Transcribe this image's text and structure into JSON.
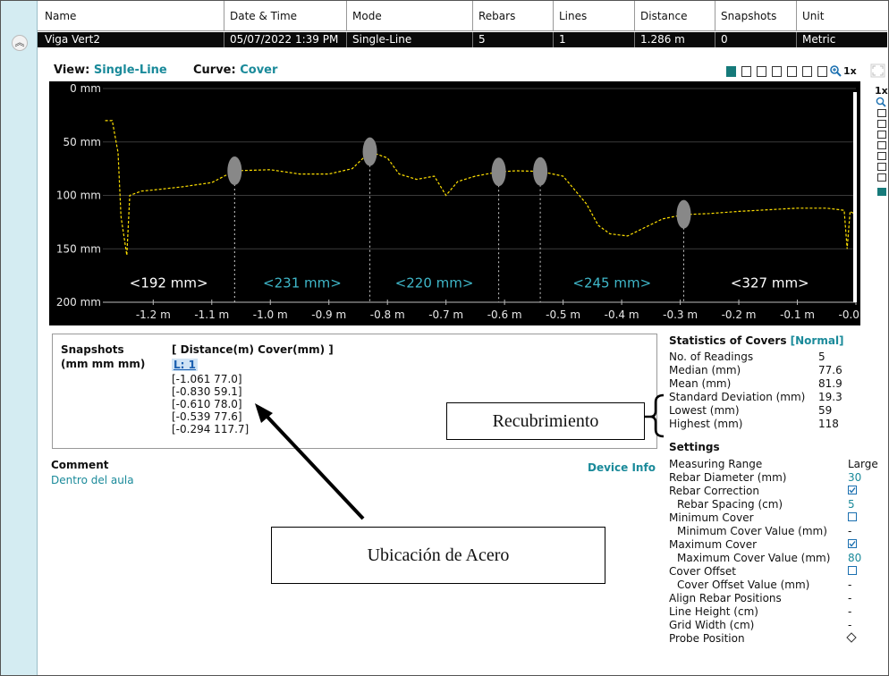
{
  "table": {
    "headers": [
      "Name",
      "Date & Time",
      "Mode",
      "Rebars",
      "Lines",
      "Distance",
      "Snapshots",
      "Unit"
    ],
    "row": [
      "Viga Vert2",
      "05/07/2022 1:39 PM",
      "Single-Line",
      "5",
      "1",
      "1.286 m",
      "0",
      "Metric"
    ]
  },
  "view": {
    "view_label": "View:",
    "view_value": "Single-Line",
    "curve_label": "Curve:",
    "curve_value": "Cover",
    "zoom_label": "1x",
    "side_zoom_label": "1x"
  },
  "chart_data": {
    "type": "line",
    "title": "",
    "x_ticks": [
      "-1.2 m",
      "-1.1 m",
      "-1.0 m",
      "-0.9 m",
      "-0.8 m",
      "-0.7 m",
      "-0.6 m",
      "-0.5 m",
      "-0.4 m",
      "-0.3 m",
      "-0.2 m",
      "-0.1 m",
      "-0.0 m"
    ],
    "y_ticks": [
      "0 mm",
      "50 mm",
      "100 mm",
      "150 mm",
      "200 mm"
    ],
    "xlim": [
      -1.286,
      0.0
    ],
    "ylim": [
      0,
      200
    ],
    "y_inverted": true,
    "grid": true,
    "cover_curve": {
      "x": [
        -1.282,
        -1.27,
        -1.26,
        -1.255,
        -1.245,
        -1.24,
        -1.22,
        -1.2,
        -1.15,
        -1.1,
        -1.061,
        -1.0,
        -0.95,
        -0.9,
        -0.86,
        -0.83,
        -0.8,
        -0.78,
        -0.75,
        -0.72,
        -0.7,
        -0.68,
        -0.65,
        -0.61,
        -0.58,
        -0.539,
        -0.5,
        -0.46,
        -0.44,
        -0.42,
        -0.39,
        -0.36,
        -0.33,
        -0.294,
        -0.25,
        -0.2,
        -0.1,
        -0.05,
        -0.02,
        -0.015,
        -0.01,
        0.0
      ],
      "y": [
        30,
        30,
        60,
        120,
        156,
        100,
        96,
        95,
        92,
        88,
        77,
        76,
        80,
        80,
        75,
        59,
        65,
        80,
        85,
        82,
        100,
        87,
        82,
        78,
        77,
        77.6,
        82,
        108,
        128,
        136,
        138,
        130,
        122,
        118,
        117,
        115,
        112,
        112,
        114,
        150,
        115,
        118
      ]
    },
    "rebars": [
      {
        "x": -1.061,
        "cover": 77.0
      },
      {
        "x": -0.83,
        "cover": 59.1
      },
      {
        "x": -0.61,
        "cover": 78.0
      },
      {
        "x": -0.539,
        "cover": 77.6
      },
      {
        "x": -0.294,
        "cover": 117.7
      }
    ],
    "spacing_labels": [
      {
        "text": "<192 mm>",
        "from": -1.286,
        "to": -1.061,
        "color": "#ffffff"
      },
      {
        "text": "<231 mm>",
        "from": -1.061,
        "to": -0.83,
        "color": "#3fb7c9"
      },
      {
        "text": "<220 mm>",
        "from": -0.83,
        "to": -0.61,
        "color": "#3fb7c9"
      },
      {
        "text": "<245 mm>",
        "from": -0.539,
        "to": -0.294,
        "color": "#3fb7c9"
      },
      {
        "text": "<327 mm>",
        "from": -0.294,
        "to": 0.0,
        "color": "#ffffff"
      }
    ],
    "cursor_x": -0.0
  },
  "snapshots": {
    "title": "Snapshots",
    "units": "(mm  mm  mm)",
    "header": "[ Distance(m)  Cover(mm) ]",
    "line_label": "L: 1",
    "entries": [
      "[-1.061  77.0]",
      "[-0.830  59.1]",
      "[-0.610  78.0]",
      "[-0.539  77.6]",
      "[-0.294  117.7]"
    ]
  },
  "comment": {
    "label": "Comment",
    "text": "Dentro del aula",
    "device_info": "Device Info"
  },
  "statistics": {
    "title": "Statistics of Covers",
    "status": "[Normal]",
    "rows": [
      {
        "label": "No. of Readings",
        "value": "5"
      },
      {
        "label": "Median (mm)",
        "value": "77.6"
      },
      {
        "label": "Mean (mm)",
        "value": "81.9"
      },
      {
        "label": "Standard Deviation (mm)",
        "value": "19.3"
      },
      {
        "label": "Lowest (mm)",
        "value": "59"
      },
      {
        "label": "Highest (mm)",
        "value": "118"
      }
    ]
  },
  "settings": {
    "title": "Settings",
    "rows": [
      {
        "label": "Measuring Range",
        "value": "Large",
        "indent": false
      },
      {
        "label": "Rebar Diameter (mm)",
        "value": "30",
        "indent": false
      },
      {
        "label": "Rebar Correction",
        "value": "checked",
        "indent": false
      },
      {
        "label": "Rebar Spacing (cm)",
        "value": "5",
        "indent": true
      },
      {
        "label": "Minimum Cover",
        "value": "unchecked",
        "indent": false
      },
      {
        "label": "Minimum Cover Value (mm)",
        "value": "-",
        "indent": true
      },
      {
        "label": "Maximum Cover",
        "value": "checked",
        "indent": false
      },
      {
        "label": "Maximum Cover Value (mm)",
        "value": "80",
        "indent": true
      },
      {
        "label": "Cover Offset",
        "value": "unchecked",
        "indent": false
      },
      {
        "label": "Cover Offset Value (mm)",
        "value": "-",
        "indent": true
      },
      {
        "label": "Align Rebar Positions",
        "value": "-",
        "indent": false
      },
      {
        "label": "Line Height (cm)",
        "value": "-",
        "indent": false
      },
      {
        "label": "Grid Width (cm)",
        "value": "-",
        "indent": false
      },
      {
        "label": "Probe Position",
        "value": "diamond",
        "indent": false
      }
    ]
  },
  "annotations": {
    "recubrimiento": "Recubrimiento",
    "ubicacion": "Ubicación de Acero"
  },
  "colors": {
    "teal": "#1a8a9a",
    "curve": "#ffe000",
    "chart_bg": "#000000",
    "rebar": "#888888"
  }
}
